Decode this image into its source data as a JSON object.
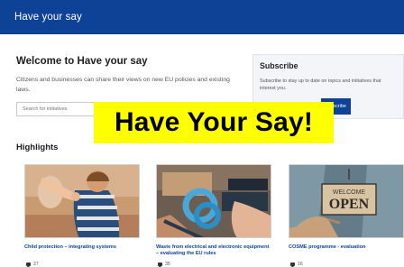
{
  "header": {
    "title": "Have your say"
  },
  "welcome": {
    "title": "Welcome to Have your say",
    "description": "Citizens and businesses can share their views on new EU policies and existing laws."
  },
  "search": {
    "placeholder": "Search for initiatives"
  },
  "subscribe": {
    "title": "Subscribe",
    "description": "Subscribe to stay up to date on topics and initiatives that interest you.",
    "button_label": "Subscribe"
  },
  "overlay": {
    "text": "Have Your Say!"
  },
  "highlights": {
    "title": "Highlights",
    "cards": [
      {
        "label": "Child protection – integrating systems",
        "comments": "27"
      },
      {
        "label": "Waste from electrical and electronic equipment – evaluating the EU rules",
        "comments": "35"
      },
      {
        "label": "COSME programme - evaluation",
        "comments": "16",
        "sign_top": "WELCOME",
        "sign_main": "OPEN"
      }
    ]
  },
  "colors": {
    "primary": "#0d4297",
    "overlay_bg": "#ffff00"
  },
  "icons": {
    "comment": "comment-bubble-icon"
  }
}
